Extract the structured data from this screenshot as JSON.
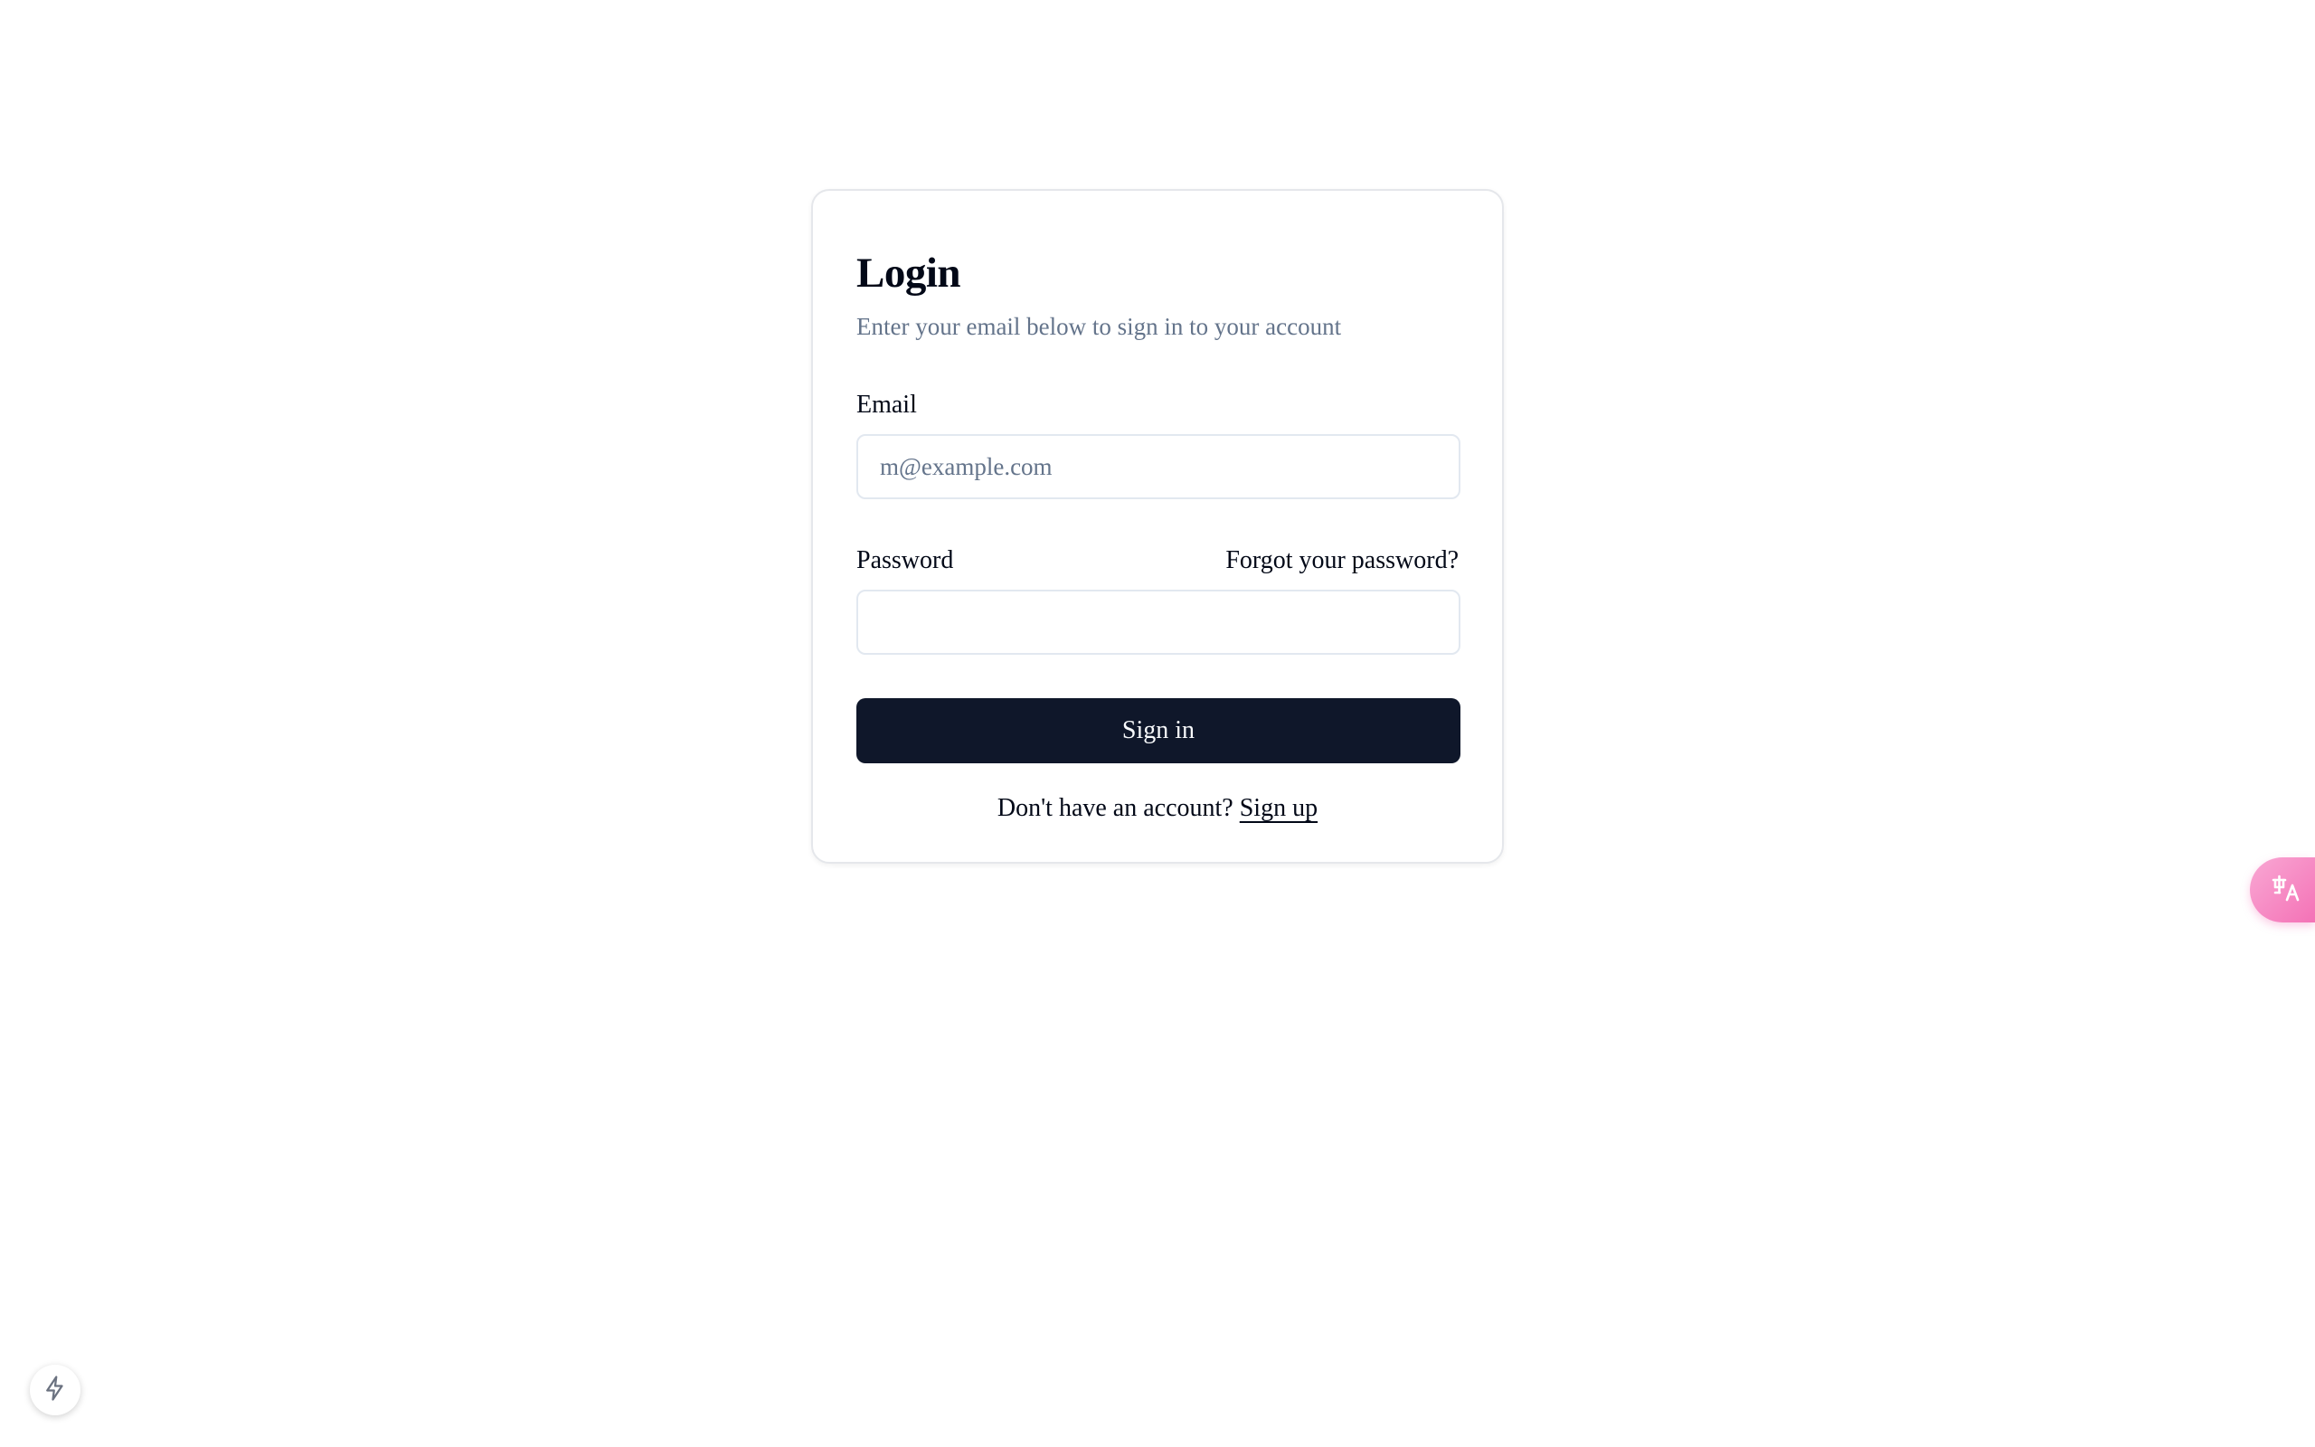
{
  "login": {
    "title": "Login",
    "description": "Enter your email below to sign in to your account",
    "email": {
      "label": "Email",
      "placeholder": "m@example.com",
      "value": ""
    },
    "password": {
      "label": "Password",
      "forgot_link": "Forgot your password?",
      "value": ""
    },
    "submit_label": "Sign in",
    "signup_prompt": "Don't have an account?",
    "signup_link": "Sign up"
  },
  "widgets": {
    "translate_icon": "translate-icon",
    "devtools_icon": "lightning-icon"
  },
  "colors": {
    "primary_button": "#0f172a",
    "muted_text": "#64748b",
    "border": "#e2e8f0",
    "translate_widget": "#f472b6"
  }
}
